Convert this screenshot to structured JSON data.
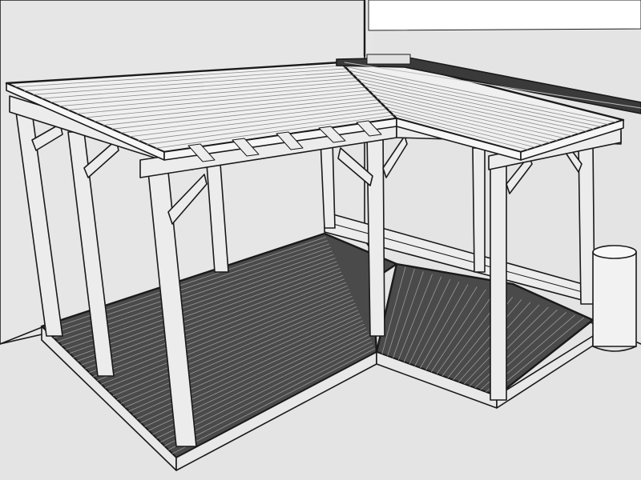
{
  "scene": {
    "background_color": "#ffffff",
    "ground_color": "#e4e4e4",
    "wall_color": "#e6e6e6",
    "sky_color": "#ffffff",
    "deck_color": "#4a4a4a",
    "roof_color": "#f0f0f0",
    "timber_color": "#ececec",
    "outline_color": "#1a1a1a"
  }
}
